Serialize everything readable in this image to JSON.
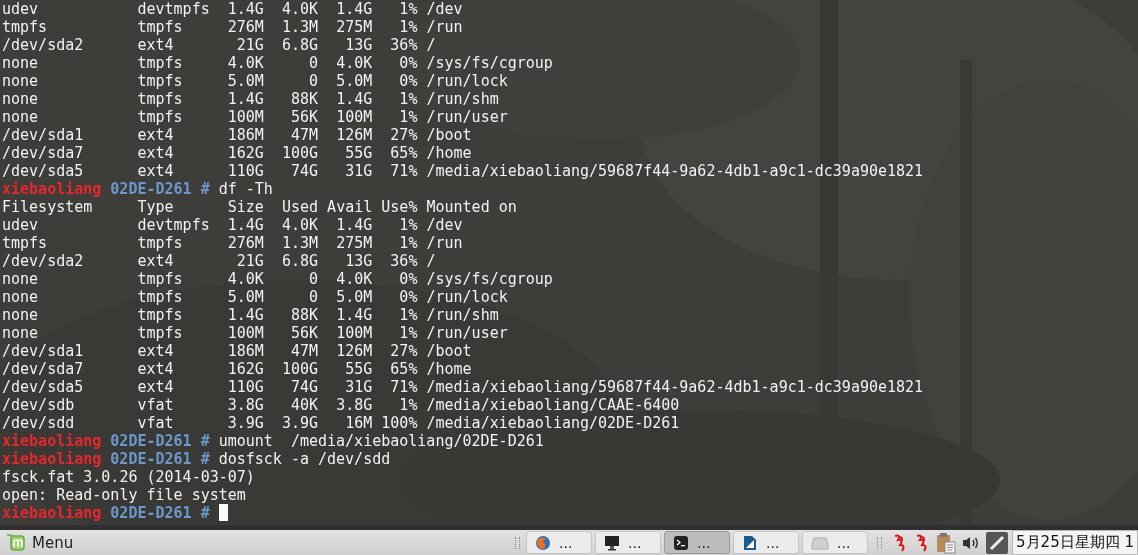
{
  "terminal": {
    "lines": [
      {
        "kind": "output",
        "text": "udev           devtmpfs  1.4G  4.0K  1.4G   1% /dev"
      },
      {
        "kind": "output",
        "text": "tmpfs          tmpfs     276M  1.3M  275M   1% /run"
      },
      {
        "kind": "output",
        "text": "/dev/sda2      ext4       21G  6.8G   13G  36% /"
      },
      {
        "kind": "output",
        "text": "none           tmpfs     4.0K     0  4.0K   0% /sys/fs/cgroup"
      },
      {
        "kind": "output",
        "text": "none           tmpfs     5.0M     0  5.0M   0% /run/lock"
      },
      {
        "kind": "output",
        "text": "none           tmpfs     1.4G   88K  1.4G   1% /run/shm"
      },
      {
        "kind": "output",
        "text": "none           tmpfs     100M   56K  100M   1% /run/user"
      },
      {
        "kind": "output",
        "text": "/dev/sda1      ext4      186M   47M  126M  27% /boot"
      },
      {
        "kind": "output",
        "text": "/dev/sda7      ext4      162G  100G   55G  65% /home"
      },
      {
        "kind": "output",
        "text": "/dev/sda5      ext4      110G   74G   31G  71% /media/xiebaoliang/59687f44-9a62-4db1-a9c1-dc39a90e1821"
      },
      {
        "kind": "prompt",
        "user": "xiebaoliang",
        "host": "02DE-D261",
        "symbol": "#",
        "command": "df -Th",
        "cursor": false
      },
      {
        "kind": "output",
        "text": "Filesystem     Type      Size  Used Avail Use% Mounted on"
      },
      {
        "kind": "output",
        "text": "udev           devtmpfs  1.4G  4.0K  1.4G   1% /dev"
      },
      {
        "kind": "output",
        "text": "tmpfs          tmpfs     276M  1.3M  275M   1% /run"
      },
      {
        "kind": "output",
        "text": "/dev/sda2      ext4       21G  6.8G   13G  36% /"
      },
      {
        "kind": "output",
        "text": "none           tmpfs     4.0K     0  4.0K   0% /sys/fs/cgroup"
      },
      {
        "kind": "output",
        "text": "none           tmpfs     5.0M     0  5.0M   0% /run/lock"
      },
      {
        "kind": "output",
        "text": "none           tmpfs     1.4G   88K  1.4G   1% /run/shm"
      },
      {
        "kind": "output",
        "text": "none           tmpfs     100M   56K  100M   1% /run/user"
      },
      {
        "kind": "output",
        "text": "/dev/sda1      ext4      186M   47M  126M  27% /boot"
      },
      {
        "kind": "output",
        "text": "/dev/sda7      ext4      162G  100G   55G  65% /home"
      },
      {
        "kind": "output",
        "text": "/dev/sda5      ext4      110G   74G   31G  71% /media/xiebaoliang/59687f44-9a62-4db1-a9c1-dc39a90e1821"
      },
      {
        "kind": "output",
        "text": "/dev/sdb       vfat      3.8G   40K  3.8G   1% /media/xiebaoliang/CAAE-6400"
      },
      {
        "kind": "output",
        "text": "/dev/sdd       vfat      3.9G  3.9G   16M 100% /media/xiebaoliang/02DE-D261"
      },
      {
        "kind": "prompt",
        "user": "xiebaoliang",
        "host": "02DE-D261",
        "symbol": "#",
        "command": "umount  /media/xiebaoliang/02DE-D261",
        "cursor": false
      },
      {
        "kind": "prompt",
        "user": "xiebaoliang",
        "host": "02DE-D261",
        "symbol": "#",
        "command": "dosfsck -a /dev/sdd",
        "cursor": false
      },
      {
        "kind": "output",
        "text": "fsck.fat 3.0.26 (2014-03-07)"
      },
      {
        "kind": "output",
        "text": "open: Read-only file system"
      },
      {
        "kind": "prompt",
        "user": "xiebaoliang",
        "host": "02DE-D261",
        "symbol": "#",
        "cursor": true
      }
    ]
  },
  "taskbar": {
    "menu": {
      "label": "Menu"
    },
    "windows": [
      {
        "kind": "browser",
        "label": "...",
        "selected": false
      },
      {
        "kind": "monitor",
        "label": "...",
        "selected": false
      },
      {
        "kind": "terminal",
        "label": "...",
        "selected": true
      },
      {
        "kind": "document",
        "label": "...",
        "selected": false
      },
      {
        "kind": "disk",
        "label": "...",
        "selected": false
      }
    ],
    "clock": "5月25日星期四 1"
  }
}
